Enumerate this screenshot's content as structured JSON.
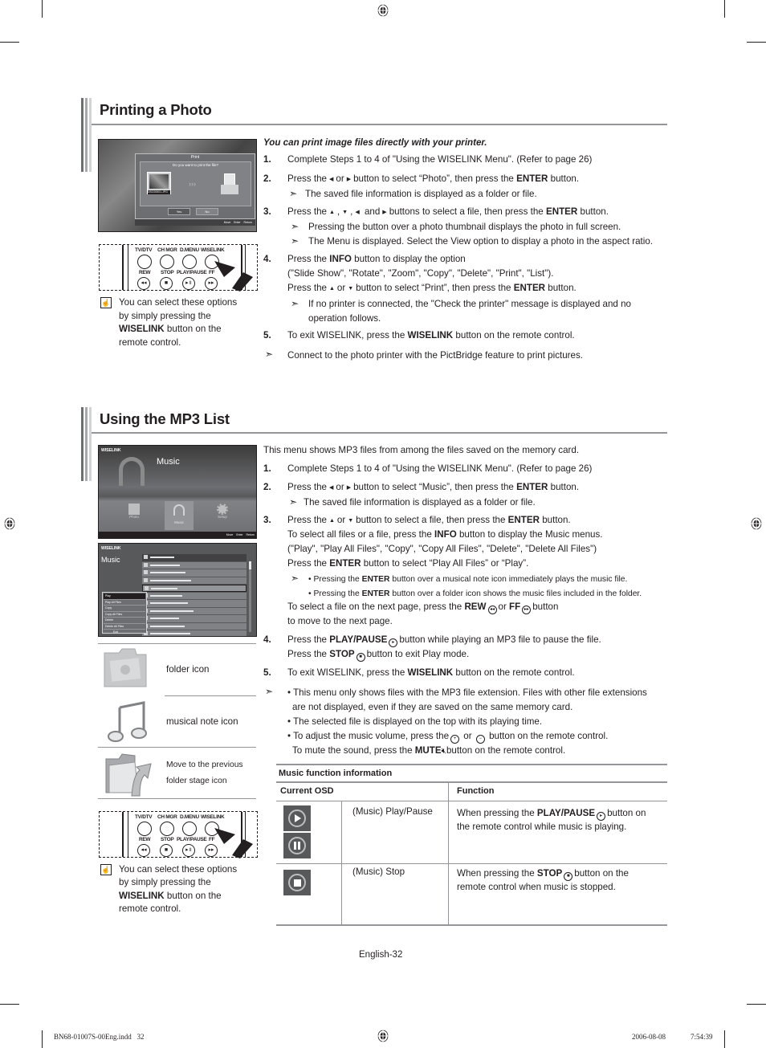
{
  "page": {
    "page_label": "English-32",
    "footer_file": "BN68-01007S-00Eng.indd   32",
    "footer_date": "2006-08-08",
    "footer_time": "7:54:39"
  },
  "printing": {
    "title": "Printing a Photo",
    "intro": "You can print image files directly with your printer.",
    "steps": [
      {
        "num": "1.",
        "text": "Complete Steps 1 to 4 of \"Using the WISELINK Menu\". (Refer to page 26)"
      },
      {
        "num": "2.",
        "pre": "Press the",
        "mid": "or",
        "post": "button to select “Photo”, then press the",
        "bold": "ENTER",
        "end": "button.",
        "note": "The saved file information is displayed as a folder or file."
      },
      {
        "num": "3.",
        "pre": "Press the",
        "mid1": ",",
        "mid2": ",",
        "and": "and",
        "post": "buttons to select a file, then press the",
        "bold": "ENTER",
        "end": "button.",
        "notes": [
          "Pressing the button over a photo thumbnail displays the photo in full screen.",
          "The Menu is displayed. Select the View option to display a photo in the aspect ratio."
        ]
      },
      {
        "num": "4.",
        "pre": "Press the",
        "bold": "INFO",
        "post": "button to display the option",
        "line2": "(\"Slide Show\", \"Rotate\", \"Zoom\", \"Copy\", \"Delete\", \"Print\", \"List\").",
        "line3_pre": "Press the",
        "line3_mid": "or",
        "line3_post": "button to select “Print”, then press the",
        "line3_bold": "ENTER",
        "line3_end": "button.",
        "note_l1": "If no printer is connected, the \"Check the printer\" message is displayed and no",
        "note_l2": "operation follows."
      },
      {
        "num": "5.",
        "pre": "To exit WISELINK, press the",
        "bold": "WISELINK",
        "post": "button on the remote control."
      }
    ],
    "final_note": "Connect to the photo printer with the PictBridge feature to print pictures.",
    "screen": {
      "dialog_title": "Print",
      "question": "Do you want to print the file?",
      "file_label": "DSC00001.JPG",
      "yes": "Yes",
      "no": "No",
      "hint_move": "Move",
      "hint_enter": "Enter",
      "hint_return": "Return"
    },
    "tip": {
      "l1": "You can select these options",
      "l2": "by simply pressing the",
      "l3_bold": "WISELINK",
      "l3_rest": "button on the",
      "l4": "remote control."
    }
  },
  "remote": {
    "top_labels": [
      "TV/DTV",
      "CH MGR",
      "D.MENU",
      "WISELINK"
    ],
    "bottom_labels": [
      "REW",
      "STOP",
      "PLAY/PAUSE",
      "FF"
    ],
    "bottom_glyphs": [
      "◂◂",
      "■",
      "▸॥",
      "▸▸"
    ]
  },
  "mp3": {
    "title": "Using the MP3 List",
    "intro": "This menu shows MP3 files from among the files saved on the memory card.",
    "s1_num": "1.",
    "s1": "Complete Steps 1 to 4 of \"Using the WISELINK Menu\". (Refer to page 26)",
    "s2_num": "2.",
    "s2_pre": "Press the",
    "s2_mid": "or",
    "s2_post": "button to select “Music”, then press the",
    "s2_bold": "ENTER",
    "s2_end": "button.",
    "s2_note": "The saved file information is displayed as a folder or file.",
    "s3_num": "3.",
    "s3_pre": "Press the",
    "s3_mid": "or",
    "s3_post": "button to select a file, then press the",
    "s3_bold": "ENTER",
    "s3_end": "button.",
    "s3_l2_pre": "To select all files or a file, press the",
    "s3_l2_bold": "INFO",
    "s3_l2_post": "button to display the Music menus.",
    "s3_l3": "(\"Play\", \"Play All Files\", \"Copy\", \"Copy All Files\", \"Delete\", \"Delete All Files\")",
    "s3_l4_pre": "Press the",
    "s3_l4_bold": "ENTER",
    "s3_l4_post": "button to select “Play All Files” or “Play”.",
    "s3_b1_pre": "• Pressing the",
    "s3_b1_bold": "ENTER",
    "s3_b1_post": "button over a musical note icon immediately plays the music file.",
    "s3_b2_pre": "• Pressing the",
    "s3_b2_bold": "ENTER",
    "s3_b2_post": "button over a folder icon shows the music files included in the folder.",
    "s3_l5_pre": "To select a file on the next page, press the",
    "s3_l5_b1": "REW",
    "s3_l5_or": "or",
    "s3_l5_b2": "FF",
    "s3_l5_post": "button",
    "s3_l6": "to move to the next page.",
    "s4_num": "4.",
    "s4_pre": "Press the",
    "s4_bold": "PLAY/PAUSE",
    "s4_post": "button while playing an MP3 file to pause the file.",
    "s4_l2_pre": "Press the",
    "s4_l2_bold": "STOP",
    "s4_l2_post": "button to exit Play mode.",
    "s5_num": "5.",
    "s5_pre": "To exit WISELINK, press the",
    "s5_bold": "WISELINK",
    "s5_post": "button on the remote control.",
    "notes": {
      "n1": "• This menu only shows files with the MP3 file extension.  Files with other file extensions",
      "n1b": "are not displayed, even if they are saved on the same memory card.",
      "n2": "• The selected file is displayed on the top with its playing time.",
      "n3_pre": "• To adjust the music volume, press the",
      "n3_or": "or",
      "n3_post": "button on the remote control.",
      "n4_pre": "To mute the sound, press the",
      "n4_bold": "MUTE",
      "n4_post": "button on the remote control."
    },
    "screen1": {
      "brand": "WISELINK",
      "heading": "Music",
      "items": [
        "Photo",
        "Music",
        "Setup"
      ],
      "hint_move": "Move",
      "hint_enter": "Enter",
      "hint_return": "Return"
    },
    "screen2": {
      "brand": "WISELINK",
      "heading": "Music",
      "menu": [
        "Play",
        "Play All Files",
        "Copy",
        "Copy All Files",
        "Delete",
        "Delete All Files"
      ],
      "exit": "Exit",
      "row_count": 11
    },
    "legend": [
      {
        "icon": "folder-icon",
        "label": "folder icon"
      },
      {
        "icon": "musical-note-icon",
        "label": "musical note icon"
      },
      {
        "icon": "previous-folder-icon",
        "label_l1": "Move to the previous",
        "label_l2": "folder stage icon"
      }
    ],
    "tip": {
      "l1": "You can select these options",
      "l2": "by simply pressing the",
      "l3_bold": "WISELINK",
      "l3_rest": "button on the",
      "l4": "remote control."
    },
    "table": {
      "caption": "Music function information",
      "col1": "Current OSD",
      "col2": "Function",
      "rows": [
        {
          "osd": "(Music) Play/Pause",
          "f_pre": "When pressing the",
          "f_bold": "PLAY/PAUSE",
          "f_post": "button on",
          "f_l2": "the remote control while music is playing."
        },
        {
          "osd": "(Music) Stop",
          "f_pre": "When pressing the",
          "f_bold": "STOP",
          "f_post": "button on the",
          "f_l2": "remote control when music is stopped."
        }
      ]
    }
  }
}
